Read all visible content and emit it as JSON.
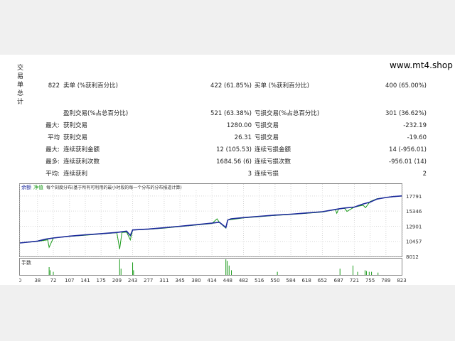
{
  "site": "www.mt4.shop",
  "side_label": "交易单总计",
  "stats": {
    "total_trades": "822",
    "short_label": "卖单 (%获利百分比)",
    "short_value": "422 (61.85%)",
    "long_label": "买单 (%获利百分比)",
    "long_value": "400 (65.00%)",
    "profit_trades_label": "盈利交易(%占总百分比)",
    "profit_trades_value": "521 (63.38%)",
    "loss_trades_label": "亏损交易(%占总百分比)",
    "loss_trades_value": "301 (36.62%)",
    "largest_prefix": "最大:",
    "largest_profit_label": "获利交易",
    "largest_profit_value": "1280.00",
    "largest_loss_label": "亏损交易",
    "largest_loss_value": "-232.19",
    "average_prefix": "平均",
    "average_profit_label": "获利交易",
    "average_profit_value": "26.31",
    "average_loss_label": "亏损交易",
    "average_loss_value": "-19.60",
    "max_prefix": "最大:",
    "max_cons_wins_label": "连续获利金额",
    "max_cons_wins_value": "12 (105.53)",
    "max_cons_losses_label": "连续亏损金额",
    "max_cons_losses_value": "14 (-956.01)",
    "maximal_prefix": "最多:",
    "maximal_cons_profit_label": "连续获利次数",
    "maximal_cons_profit_value": "1684.56 (6)",
    "maximal_cons_loss_label": "连续亏损次数",
    "maximal_cons_loss_value": "-956.01 (14)",
    "avg_prefix": "平均:",
    "avg_cons_wins_label": "连续获利",
    "avg_cons_wins_value": "3",
    "avg_cons_losses_label": "连续亏损",
    "avg_cons_losses_value": "2"
  },
  "chart_data": {
    "type": "line",
    "legend": {
      "balance": "余额",
      "equity": "净值",
      "note": "每个刻度分布(基于所有可利用的最小时段的每一个分布的分布报道计算)"
    },
    "panel_label": "手数",
    "x_ticks": [
      0,
      38,
      72,
      107,
      141,
      175,
      209,
      243,
      277,
      311,
      345,
      380,
      414,
      448,
      482,
      516,
      550,
      584,
      618,
      652,
      687,
      721,
      755,
      789,
      823
    ],
    "y_ticks": [
      17791,
      15346,
      12901,
      10457,
      8012
    ],
    "xlim": [
      0,
      823
    ],
    "ylim": [
      8012,
      18700
    ],
    "series": [
      {
        "name": "余额",
        "color": "#1c2a9c",
        "x": [
          0,
          38,
          55,
          72,
          107,
          141,
          175,
          209,
          230,
          238,
          243,
          277,
          311,
          345,
          380,
          414,
          430,
          444,
          448,
          455,
          482,
          516,
          550,
          584,
          618,
          652,
          687,
          700,
          721,
          740,
          755,
          770,
          789,
          805,
          823
        ],
        "y": [
          10200,
          10500,
          10800,
          11000,
          11300,
          11500,
          11700,
          11900,
          12100,
          11400,
          12300,
          12450,
          12650,
          12900,
          13150,
          13400,
          13550,
          12700,
          13900,
          14100,
          14300,
          14500,
          14700,
          14850,
          15050,
          15250,
          15700,
          15850,
          16000,
          16500,
          16800,
          17300,
          17550,
          17700,
          17800
        ]
      },
      {
        "name": "净值",
        "color": "#1a9a1a",
        "x": [
          0,
          38,
          60,
          63,
          72,
          107,
          141,
          175,
          209,
          215,
          220,
          230,
          238,
          243,
          277,
          311,
          345,
          380,
          414,
          425,
          430,
          444,
          448,
          482,
          516,
          550,
          584,
          618,
          652,
          680,
          683,
          687,
          700,
          705,
          721,
          740,
          745,
          755,
          770,
          789,
          823
        ],
        "y": [
          10200,
          10450,
          10700,
          9500,
          11000,
          11250,
          11450,
          11650,
          11850,
          9200,
          11900,
          11950,
          10700,
          12300,
          12400,
          12600,
          12850,
          13100,
          13350,
          14100,
          13500,
          12600,
          13900,
          14250,
          14450,
          14650,
          14800,
          15000,
          15200,
          15600,
          15000,
          15700,
          15800,
          15300,
          16000,
          16300,
          15900,
          16900,
          17350,
          17550,
          17800
        ]
      }
    ],
    "lots": {
      "x": [
        63,
        65,
        72,
        215,
        218,
        243,
        245,
        444,
        447,
        451,
        456,
        555,
        690,
        718,
        728,
        744,
        747,
        753,
        758,
        772
      ],
      "y": [
        0.5,
        0.3,
        0.2,
        1.0,
        0.4,
        0.8,
        0.3,
        1.0,
        0.9,
        0.6,
        0.3,
        0.2,
        0.4,
        0.6,
        0.2,
        0.3,
        0.25,
        0.2,
        0.2,
        0.15
      ]
    }
  }
}
